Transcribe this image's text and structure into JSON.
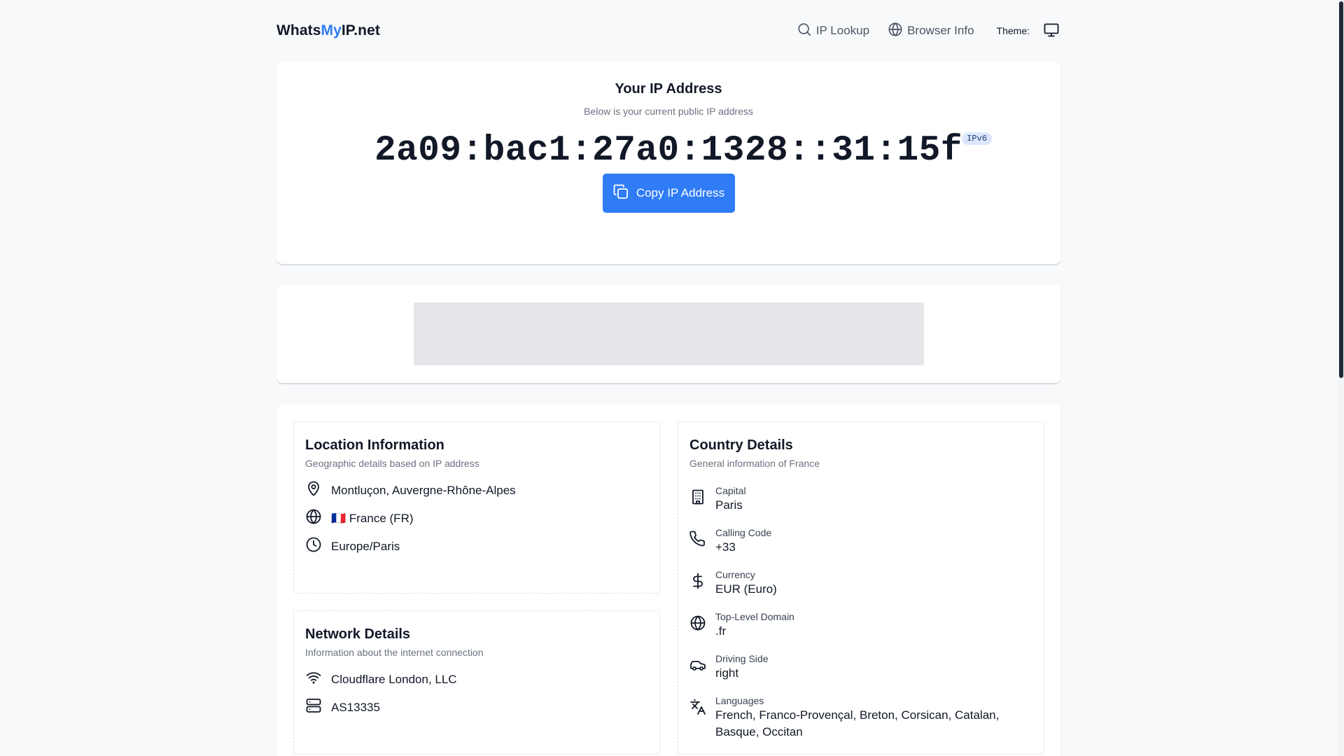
{
  "header": {
    "logo_part1": "Whats",
    "logo_part2": "My",
    "logo_part3": "IP.net",
    "nav": [
      {
        "label": "IP Lookup",
        "icon": "search-icon"
      },
      {
        "label": "Browser Info",
        "icon": "globe-icon"
      }
    ],
    "theme_label": "Theme:",
    "theme_icon": "monitor-icon"
  },
  "ip_card": {
    "title": "Your IP Address",
    "subtitle": "Below is your current public IP address",
    "ip": "2a09:bac1:27a0:1328::31:15f",
    "badge": "IPv6",
    "copy_label": "Copy IP Address"
  },
  "location": {
    "title": "Location Information",
    "subtitle": "Geographic details based on IP address",
    "city": "Montluçon, Auvergne-Rhône-Alpes",
    "country": "🇫🇷 France (FR)",
    "timezone": "Europe/Paris"
  },
  "network": {
    "title": "Network Details",
    "subtitle": "Information about the internet connection",
    "isp": "Cloudflare London, LLC",
    "asn": "AS13335"
  },
  "country": {
    "title": "Country Details",
    "subtitle": "General information of France",
    "items": [
      {
        "label": "Capital",
        "value": "Paris",
        "icon": "building-icon"
      },
      {
        "label": "Calling Code",
        "value": "+33",
        "icon": "phone-icon"
      },
      {
        "label": "Currency",
        "value": "EUR (Euro)",
        "icon": "dollar-icon"
      },
      {
        "label": "Top-Level Domain",
        "value": ".fr",
        "icon": "globe-icon"
      },
      {
        "label": "Driving Side",
        "value": "right",
        "icon": "car-icon"
      },
      {
        "label": "Languages",
        "value": "French, Franco-Provençal, Breton, Corsican, Catalan, Basque, Occitan",
        "icon": "translate-icon"
      }
    ]
  },
  "colors": {
    "accent": "#2f7cf6",
    "page_bg": "#f8f9fb",
    "ad_placeholder": "#e5e7eb"
  }
}
